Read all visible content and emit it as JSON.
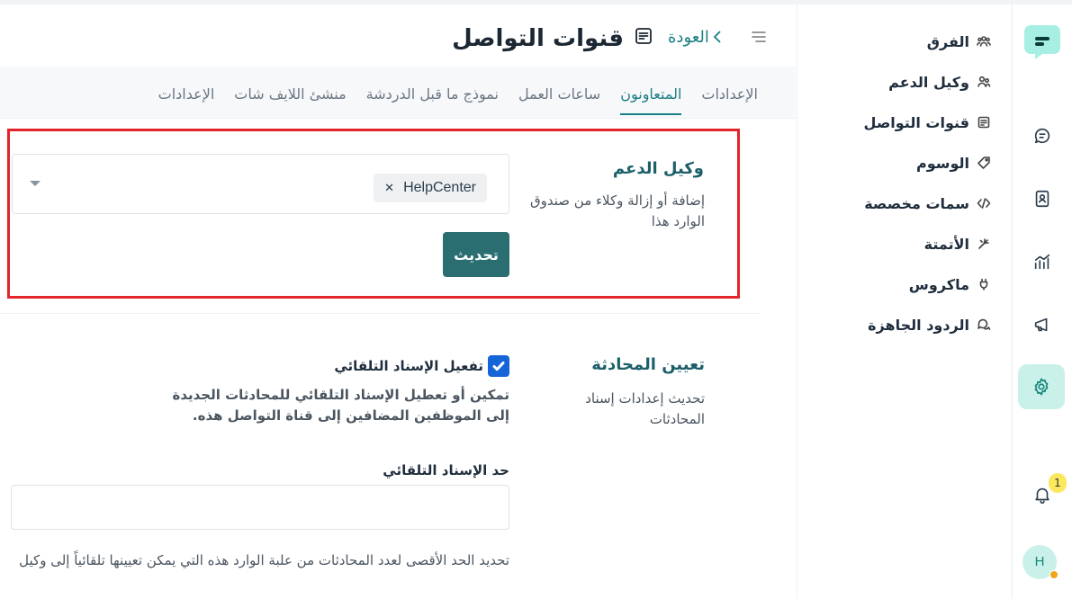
{
  "header": {
    "title": "قنوات التواصل",
    "back_label": "العودة"
  },
  "tabs": [
    {
      "label": "الإعدادات",
      "active": false
    },
    {
      "label": "المتعاونون",
      "active": true
    },
    {
      "label": "ساعات العمل",
      "active": false
    },
    {
      "label": "نموذج ما قبل الدردشة",
      "active": false
    },
    {
      "label": "منشئ اللايف شات",
      "active": false
    },
    {
      "label": "الإعدادات",
      "active": false
    }
  ],
  "sidebar": {
    "items": [
      {
        "label": "الفرق",
        "icon": "teams-icon"
      },
      {
        "label": "وكيل الدعم",
        "icon": "agents-icon"
      },
      {
        "label": "قنوات التواصل",
        "icon": "inbox-icon"
      },
      {
        "label": "الوسوم",
        "icon": "tag-icon"
      },
      {
        "label": "سمات مخصصة",
        "icon": "code-icon"
      },
      {
        "label": "الأتمتة",
        "icon": "automation-icon"
      },
      {
        "label": "ماكروس",
        "icon": "macros-icon"
      },
      {
        "label": "الردود الجاهزة",
        "icon": "canned-responses-icon"
      }
    ]
  },
  "rail": {
    "notification_count": "1",
    "avatar_initial": "H",
    "accent": "#16857a"
  },
  "agents_section": {
    "title": "وكيل الدعم",
    "description": "إضافة أو إزالة وكلاء من صندوق الوارد هذا",
    "selected_agents": [
      "HelpCenter"
    ],
    "update_button": "تحديث"
  },
  "assignment_section": {
    "title": "تعيين المحادثة",
    "description": "تحديث إعدادات إسناد المحادثات",
    "auto_assign_label": "تفعيل الإسناد التلقائي",
    "auto_assign_checked": true,
    "auto_assign_description": "تمكين أو تعطيل الإسناد التلقائي للمحادثات الجديدة إلى الموظفين المضافين إلى قناة التواصل هذه.",
    "limit_label": "حد الإسناد التلقائي",
    "limit_value": "",
    "limit_help": "تحديد الحد الأقصى لعدد المحادثات من علبة الوارد هذه التي يمكن تعيينها تلقائياً إلى وكيل"
  }
}
